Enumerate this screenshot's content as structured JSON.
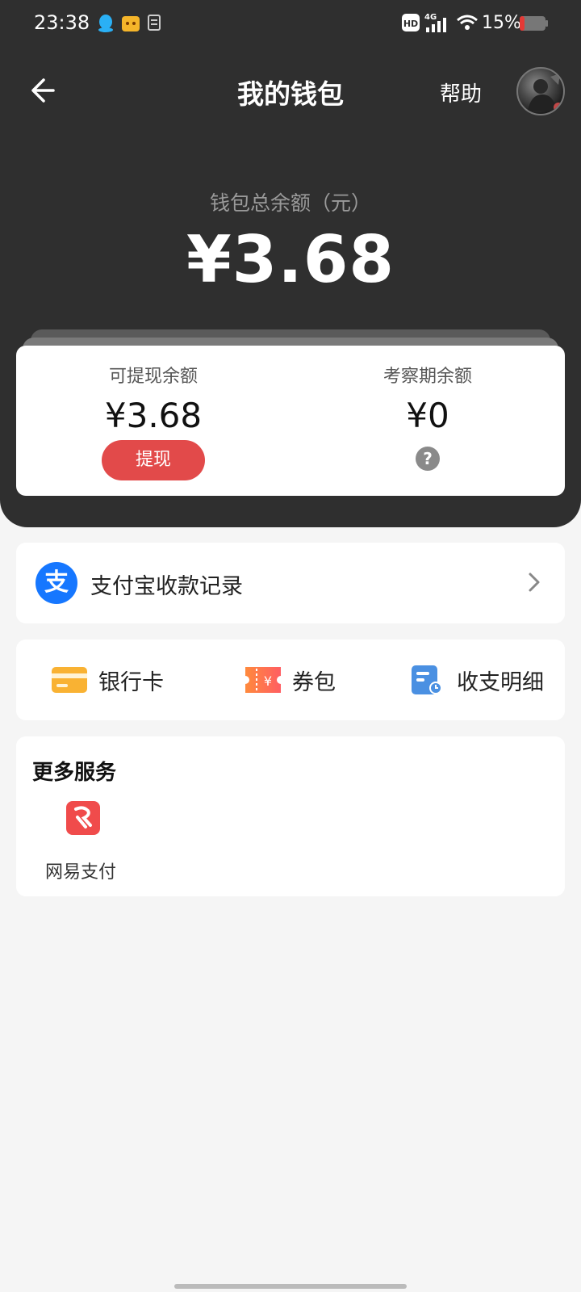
{
  "status_bar": {
    "time": "23:38",
    "battery_percent": "15%",
    "network": "4G",
    "hd_label": "HD",
    "icons": [
      "qq-icon",
      "video-app-icon",
      "document-icon",
      "hd-icon",
      "signal-icon",
      "wifi-icon",
      "battery-icon"
    ]
  },
  "nav": {
    "title": "我的钱包",
    "help": "帮助"
  },
  "wallet": {
    "total_label": "钱包总余额（元）",
    "total_amount": "¥3.68"
  },
  "balances": {
    "withdrawable_label": "可提现余额",
    "withdrawable_amount": "¥3.68",
    "withdraw_button": "提现",
    "pending_label": "考察期余额",
    "pending_amount": "¥0",
    "help_glyph": "?"
  },
  "alipay": {
    "logo_glyph": "支",
    "label": "支付宝收款记录"
  },
  "quick_actions": [
    {
      "label": "银行卡",
      "icon": "bank-card-icon"
    },
    {
      "label": "券包",
      "icon": "coupon-icon"
    },
    {
      "label": "收支明细",
      "icon": "transaction-detail-icon"
    }
  ],
  "more_services": {
    "title": "更多服务",
    "items": [
      {
        "label": "网易支付",
        "icon": "netease-pay-icon"
      }
    ]
  },
  "colors": {
    "header_bg": "#2f2f2f",
    "accent_red": "#e24a4a",
    "alipay_blue": "#1677ff",
    "page_bg": "#f5f5f5"
  }
}
